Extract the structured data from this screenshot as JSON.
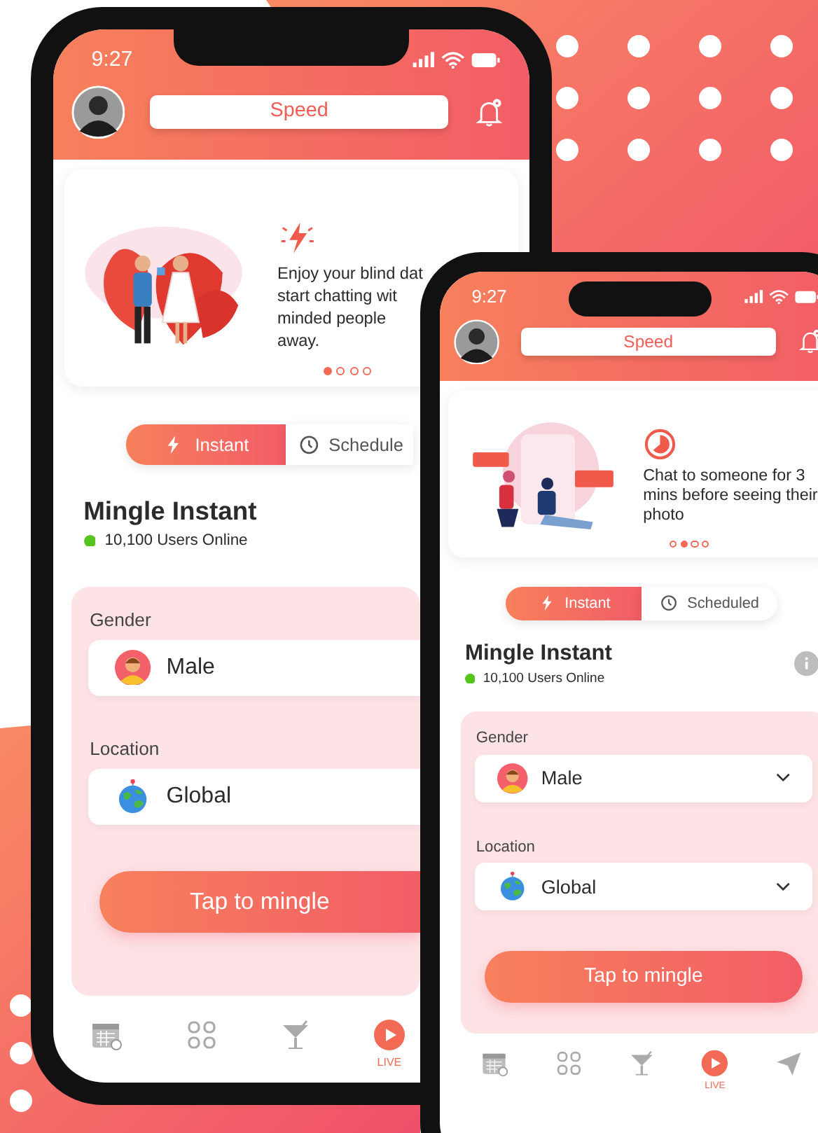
{
  "phones": [
    {
      "status_time": "9:27",
      "header_title": "Speed",
      "card": {
        "text_lines": [
          "Enjoy your blind dat",
          "start chatting wit",
          "minded people",
          "away."
        ],
        "dots": [
          {
            "selected": true
          },
          {
            "selected": false
          },
          {
            "selected": false
          },
          {
            "selected": false
          }
        ]
      },
      "tabs": [
        {
          "label": "Instant",
          "selected": true
        },
        {
          "label": "Schedule",
          "selected": false
        }
      ],
      "title": "Mingle Instant",
      "users_online": "10,100 Users Online",
      "fields": [
        {
          "label": "Gender",
          "value": "Male"
        },
        {
          "label": "Location",
          "value": "Global"
        }
      ],
      "action": "Tap to mingle",
      "nav": [
        {
          "selected": false
        },
        {
          "selected": false
        },
        {
          "selected": false
        },
        {
          "label": "LIVE",
          "selected": true
        }
      ]
    },
    {
      "status_time": "9:27",
      "header_title": "Speed",
      "card": {
        "text_lines": [
          "Chat to someone for 3",
          "mins before seeing their",
          "photo"
        ],
        "dots": [
          {
            "selected": false
          },
          {
            "selected": true
          },
          {
            "selected": false
          },
          {
            "selected": false
          }
        ]
      },
      "tabs": [
        {
          "label": "Instant",
          "selected": true
        },
        {
          "label": "Scheduled",
          "selected": false
        }
      ],
      "title": "Mingle Instant",
      "users_online": "10,100 Users Online",
      "info_button": true,
      "fields": [
        {
          "label": "Gender",
          "value": "Male",
          "dropdown": true
        },
        {
          "label": "Location",
          "value": "Global",
          "dropdown": true
        }
      ],
      "action": "Tap to mingle",
      "nav": [
        {
          "selected": false
        },
        {
          "selected": false
        },
        {
          "selected": false
        },
        {
          "label": "LIVE",
          "selected": true
        },
        {
          "selected": false
        }
      ]
    }
  ]
}
